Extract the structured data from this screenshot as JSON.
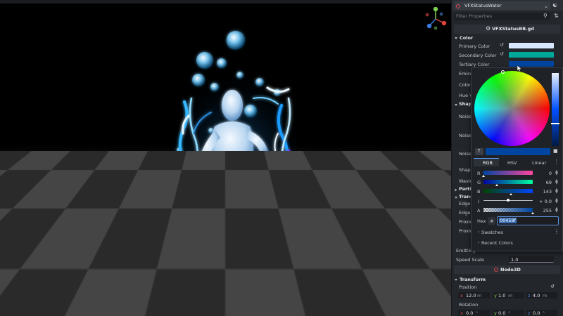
{
  "inspector": {
    "node_name": "VFXStatusWater",
    "filter_placeholder": "Filter Properties",
    "script_name": "VFXStatusBB.gd",
    "sections": {
      "color": "Color",
      "shape": "Shape",
      "particles": "Partic",
      "transform_short": "Transf",
      "node3d": "Node3D",
      "transform": "Transform"
    },
    "color_props": [
      {
        "label": "Primary Color",
        "color": "#D8E6FF"
      },
      {
        "label": "Secondary Color",
        "color": "#00A89A"
      },
      {
        "label": "Tertiary Color",
        "color": "#0045A0"
      }
    ],
    "partial_labels": [
      "Emiss",
      "Color",
      "Hue V",
      "Noise",
      "Noise",
      "Noise",
      "Shape",
      "Wavin",
      "Edge",
      "Edge",
      "Proxim",
      "Proxim"
    ],
    "emitting_label": "Emitting",
    "speed_scale_label": "Speed Scale",
    "speed_scale_value": "1.0",
    "position_label": "Position",
    "position": [
      {
        "axis": "x",
        "value": "12.0",
        "unit": "m"
      },
      {
        "axis": "y",
        "value": "1.0",
        "unit": "m"
      },
      {
        "axis": "z",
        "value": "4.0",
        "unit": "m"
      }
    ],
    "rotation_label": "Rotation",
    "rotation": [
      {
        "axis": "x",
        "value": "0.0",
        "unit": "°"
      },
      {
        "axis": "y",
        "value": "0.0",
        "unit": "°"
      },
      {
        "axis": "z",
        "value": "0.0",
        "unit": "°"
      }
    ]
  },
  "picker": {
    "tabs": [
      "RGB",
      "HSV",
      "Linear"
    ],
    "current_color": "#0045A0",
    "channels": [
      {
        "label": "R",
        "value": "0",
        "fraction": 0.0
      },
      {
        "label": "G",
        "value": "69",
        "fraction": 0.27
      },
      {
        "label": "B",
        "value": "143",
        "fraction": 0.56
      },
      {
        "label": "I",
        "value": "+ 0.0",
        "fraction": 0.5
      },
      {
        "label": "A",
        "value": "255",
        "fraction": 1.0
      }
    ],
    "hex_label": "Hex",
    "hash": "#",
    "hex_value": "00459f",
    "swatches_label": "Swatches",
    "recent_label": "Recent Colors"
  }
}
